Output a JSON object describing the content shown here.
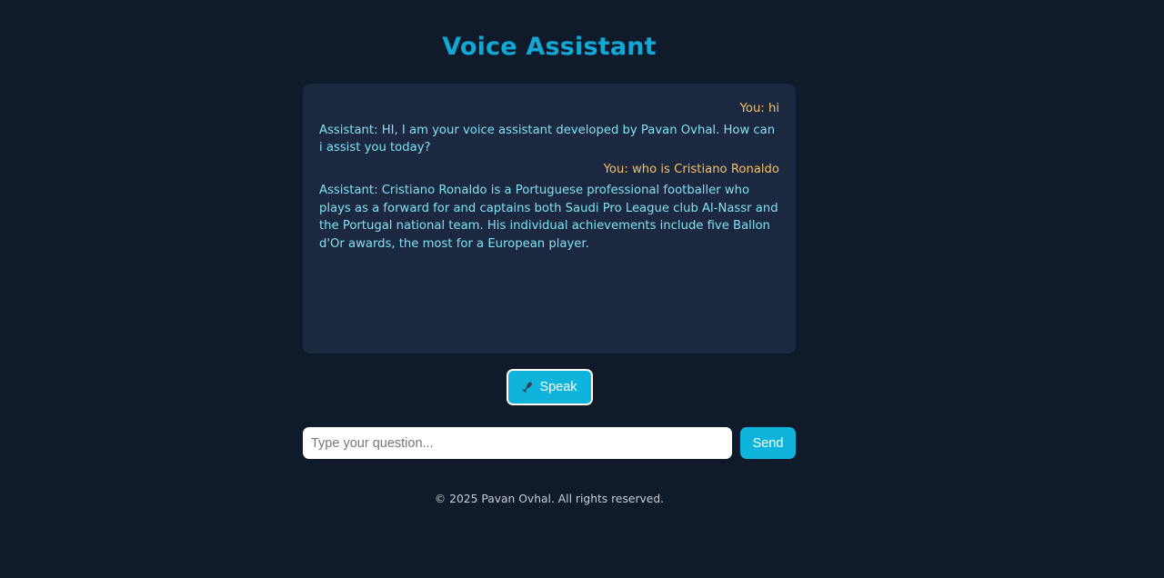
{
  "app": {
    "title": "Voice Assistant"
  },
  "chat": {
    "messages": [
      {
        "role": "user",
        "text": "You: hi"
      },
      {
        "role": "assistant",
        "text": "Assistant: HI, I am your voice assistant developed by Pavan Ovhal. How can i assist you today?"
      },
      {
        "role": "user",
        "text": "You: who is Cristiano Ronaldo"
      },
      {
        "role": "assistant",
        "text": "Assistant: Cristiano Ronaldo is a Portuguese professional footballer who plays as a forward for and captains both Saudi Pro League club Al-Nassr and the Portugal national team. His individual achievements include five Ballon d'Or awards, the most for a European player."
      }
    ]
  },
  "controls": {
    "speak_label": "Speak",
    "speak_icon": "microphone-icon",
    "input_placeholder": "Type your question...",
    "input_value": "",
    "send_label": "Send"
  },
  "footer": {
    "text": "© 2025 Pavan Ovhal. All rights reserved."
  },
  "colors": {
    "background": "#0f1a2b",
    "panel": "#1c2840",
    "accent": "#0fb4dc",
    "user_text": "#f4c064",
    "assistant_text": "#7ee2f2"
  }
}
